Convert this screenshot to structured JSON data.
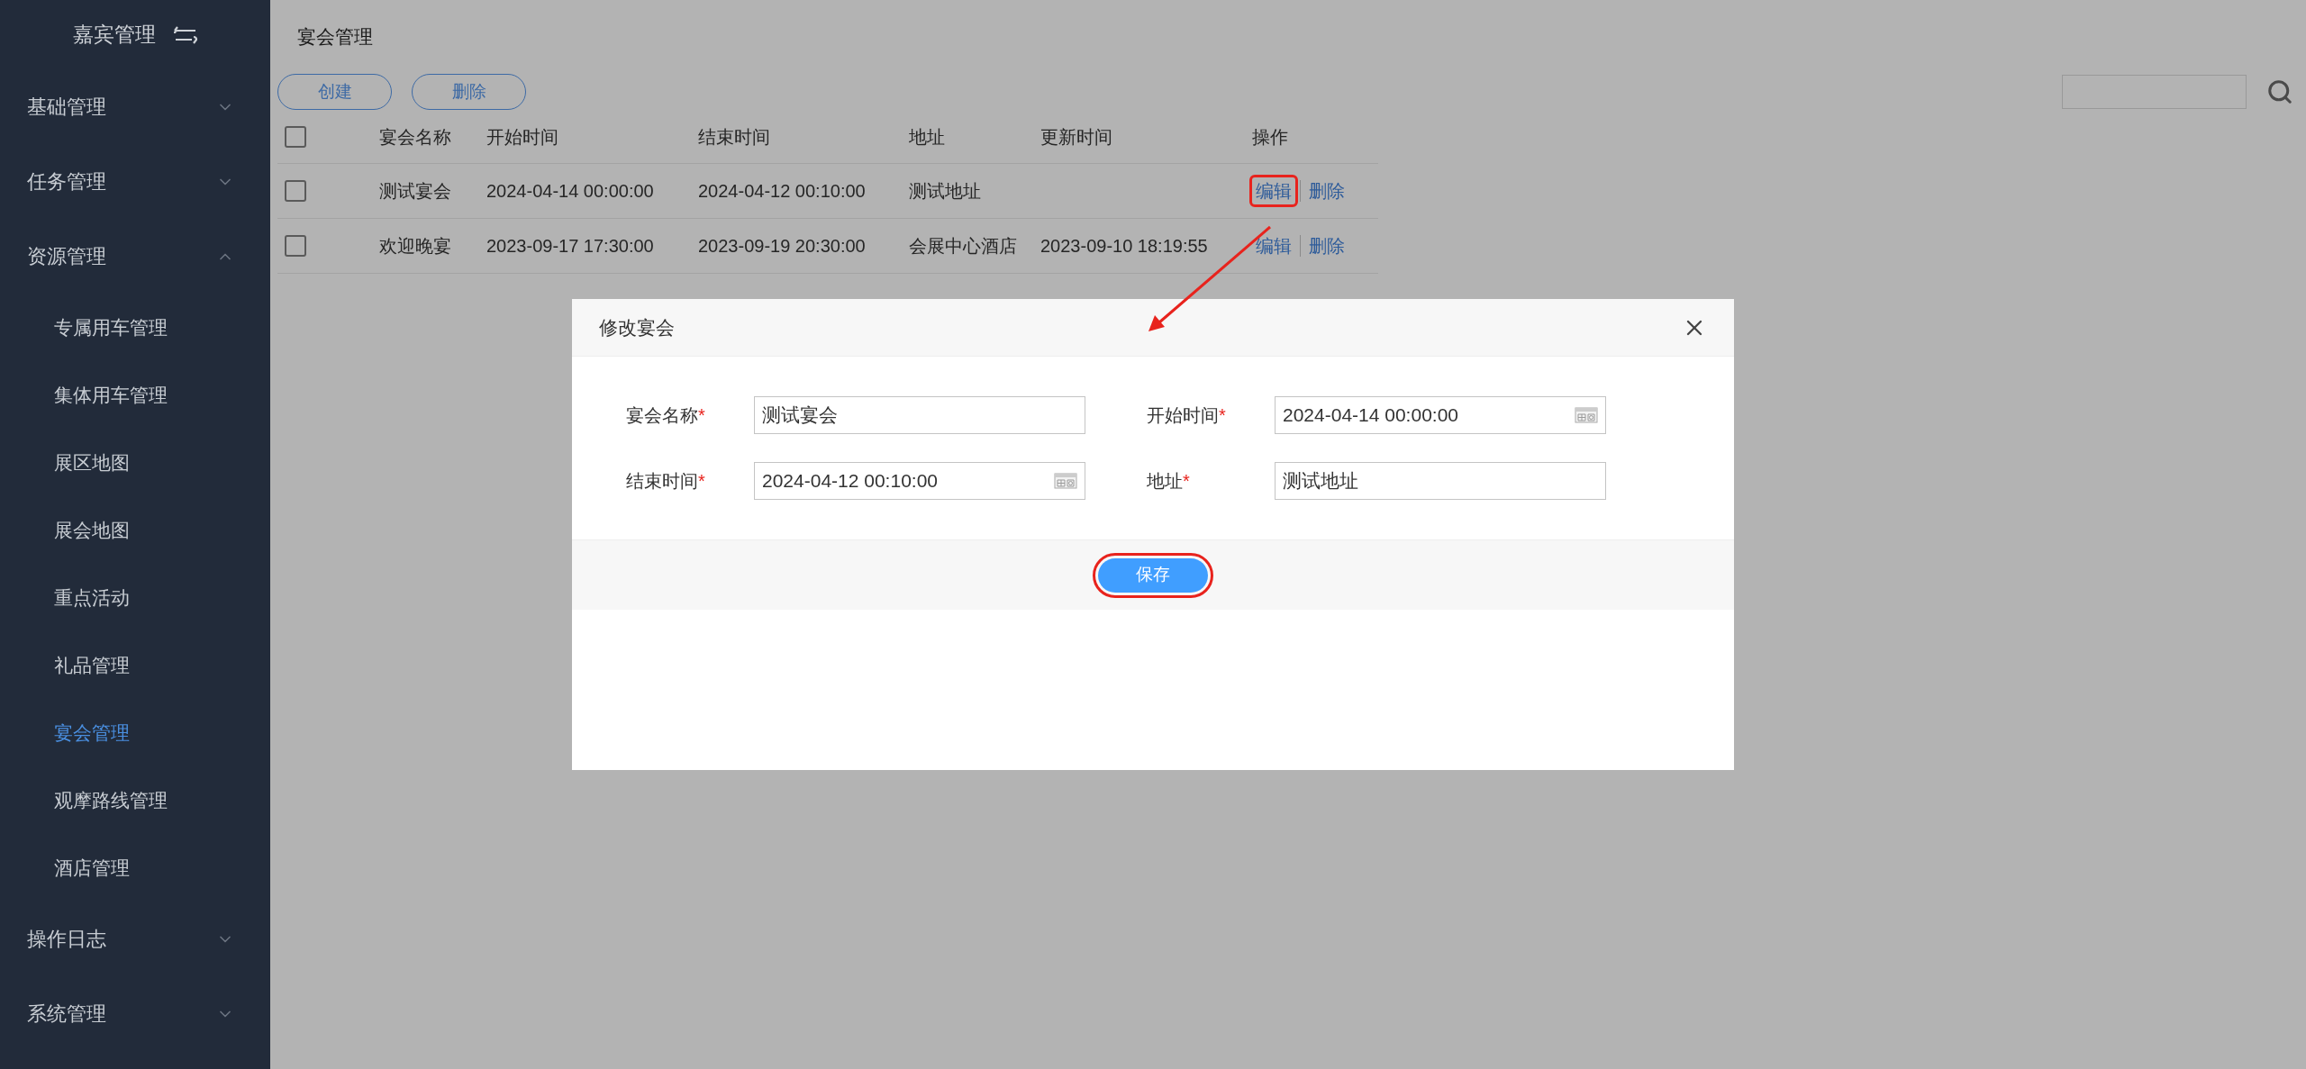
{
  "sidebar": {
    "title": "嘉宾管理",
    "menu": [
      {
        "label": "基础管理",
        "expanded": false
      },
      {
        "label": "任务管理",
        "expanded": false
      },
      {
        "label": "资源管理",
        "expanded": true,
        "children": [
          {
            "label": "专属用车管理",
            "selected": false
          },
          {
            "label": "集体用车管理",
            "selected": false
          },
          {
            "label": "展区地图",
            "selected": false
          },
          {
            "label": "展会地图",
            "selected": false
          },
          {
            "label": "重点活动",
            "selected": false
          },
          {
            "label": "礼品管理",
            "selected": false
          },
          {
            "label": "宴会管理",
            "selected": true
          },
          {
            "label": "观摩路线管理",
            "selected": false
          },
          {
            "label": "酒店管理",
            "selected": false
          }
        ]
      },
      {
        "label": "操作日志",
        "expanded": false
      },
      {
        "label": "系统管理",
        "expanded": false
      }
    ]
  },
  "page_title": "宴会管理",
  "toolbar": [
    "创建",
    "删除"
  ],
  "table": {
    "select_all_checked": false,
    "columns": [
      "宴会名称",
      "开始时间",
      "结束时间",
      "地址",
      "更新时间",
      "操作"
    ],
    "rows": [
      {
        "checked": false,
        "cells": [
          "测试宴会",
          "2024-04-14 00:00:00",
          "2024-04-12 00:10:00",
          "测试地址",
          ""
        ],
        "actions": [
          {
            "label": "编辑",
            "highlighted": true
          },
          {
            "label": "删除",
            "highlighted": false
          }
        ]
      },
      {
        "checked": false,
        "cells": [
          "欢迎晚宴",
          "2023-09-17 17:30:00",
          "2023-09-19 20:30:00",
          "会展中心酒店",
          "2023-09-10 18:19:55"
        ],
        "actions": [
          {
            "label": "编辑",
            "highlighted": false
          },
          {
            "label": "删除",
            "highlighted": false
          }
        ]
      }
    ]
  },
  "dialog": {
    "title": "修改宴会",
    "fields": [
      {
        "label": "宴会名称",
        "required_mark": "*",
        "value": "测试宴会",
        "kind": "text"
      },
      {
        "label": "开始时间",
        "required_mark": "*",
        "value": "2024-04-14 00:00:00",
        "kind": "date"
      },
      {
        "label": "结束时间",
        "required_mark": "*",
        "value": "2024-04-12 00:10:00",
        "kind": "date"
      },
      {
        "label": "地址",
        "required_mark": "*",
        "value": "测试地址",
        "kind": "text"
      }
    ],
    "save": {
      "label": "保存",
      "highlighted": true
    }
  }
}
